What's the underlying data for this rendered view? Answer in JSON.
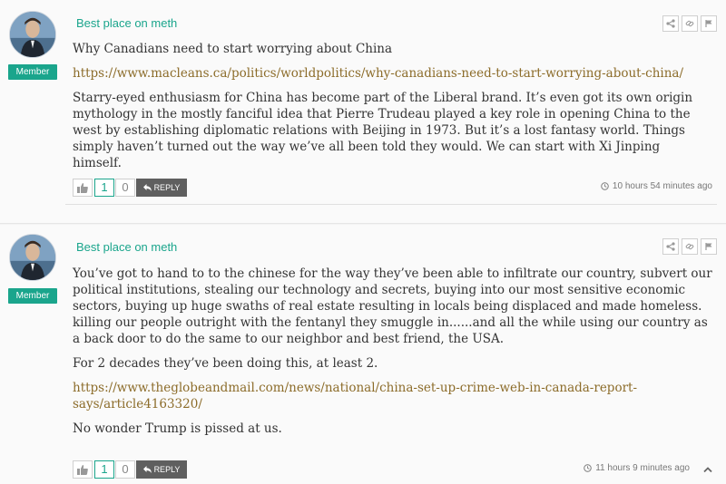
{
  "comments": [
    {
      "username": "Best place on meth",
      "role": "Member",
      "paragraphs": [
        "Why Canadians need to start worrying about China",
        "https://www.macleans.ca/politics/worldpolitics/why-canadians-need-to-start-worrying-about-china/",
        "Starry-eyed enthusiasm for China has become part of the Liberal brand. It’s even got its own origin mythology in the mostly fanciful idea that Pierre Trudeau played a key role in opening China to the west by establishing diplomatic relations with Beijing in 1973. But it’s a lost fantasy world. Things simply haven’t turned out the way we’ve all been told they would. We can start with Xi Jinping himself."
      ],
      "likes": "1",
      "dislikes": "0",
      "reply_label": "REPLY",
      "timestamp": "10 hours 54 minutes ago"
    },
    {
      "username": "Best place on meth",
      "role": "Member",
      "paragraphs": [
        "You’ve got to hand to to the chinese for the way they’ve been able to infiltrate our country, subvert our political institutions, stealing our technology and secrets, buying into our most sensitive economic sectors, buying up huge swaths of real estate resulting in locals being displaced and made homeless. killing our people outright with the fentanyl they smuggle in......and all the while using our country as a back door to do the same to our neighbor and best friend, the USA.",
        "For 2 decades they’ve been doing this, at least 2.",
        "https://www.theglobeandmail.com/news/national/china-set-up-crime-web-in-canada-report-says/article4163320/",
        "No wonder Trump is pissed at us."
      ],
      "likes": "1",
      "dislikes": "0",
      "reply_label": "REPLY",
      "timestamp": "11 hours 9 minutes ago"
    }
  ],
  "icons": [
    "share-icon",
    "link-icon",
    "flag-icon",
    "thumbs-up-icon",
    "reply-arrow-icon",
    "clock-icon",
    "chevron-up-icon"
  ],
  "colors": {
    "accent": "#1aa58c",
    "link": "#8c6c2a",
    "reply_bg": "#5f5f5f"
  }
}
